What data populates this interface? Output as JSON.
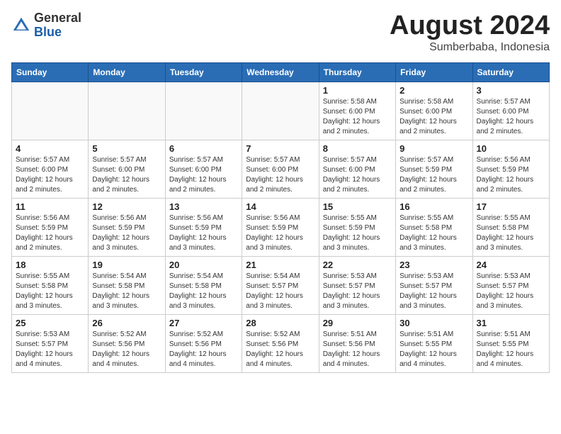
{
  "header": {
    "logo_general": "General",
    "logo_blue": "Blue",
    "calendar_title": "August 2024",
    "calendar_subtitle": "Sumberbaba, Indonesia"
  },
  "days_of_week": [
    "Sunday",
    "Monday",
    "Tuesday",
    "Wednesday",
    "Thursday",
    "Friday",
    "Saturday"
  ],
  "weeks": [
    [
      {
        "day": "",
        "info": ""
      },
      {
        "day": "",
        "info": ""
      },
      {
        "day": "",
        "info": ""
      },
      {
        "day": "",
        "info": ""
      },
      {
        "day": "1",
        "info": "Sunrise: 5:58 AM\nSunset: 6:00 PM\nDaylight: 12 hours\nand 2 minutes."
      },
      {
        "day": "2",
        "info": "Sunrise: 5:58 AM\nSunset: 6:00 PM\nDaylight: 12 hours\nand 2 minutes."
      },
      {
        "day": "3",
        "info": "Sunrise: 5:57 AM\nSunset: 6:00 PM\nDaylight: 12 hours\nand 2 minutes."
      }
    ],
    [
      {
        "day": "4",
        "info": "Sunrise: 5:57 AM\nSunset: 6:00 PM\nDaylight: 12 hours\nand 2 minutes."
      },
      {
        "day": "5",
        "info": "Sunrise: 5:57 AM\nSunset: 6:00 PM\nDaylight: 12 hours\nand 2 minutes."
      },
      {
        "day": "6",
        "info": "Sunrise: 5:57 AM\nSunset: 6:00 PM\nDaylight: 12 hours\nand 2 minutes."
      },
      {
        "day": "7",
        "info": "Sunrise: 5:57 AM\nSunset: 6:00 PM\nDaylight: 12 hours\nand 2 minutes."
      },
      {
        "day": "8",
        "info": "Sunrise: 5:57 AM\nSunset: 6:00 PM\nDaylight: 12 hours\nand 2 minutes."
      },
      {
        "day": "9",
        "info": "Sunrise: 5:57 AM\nSunset: 5:59 PM\nDaylight: 12 hours\nand 2 minutes."
      },
      {
        "day": "10",
        "info": "Sunrise: 5:56 AM\nSunset: 5:59 PM\nDaylight: 12 hours\nand 2 minutes."
      }
    ],
    [
      {
        "day": "11",
        "info": "Sunrise: 5:56 AM\nSunset: 5:59 PM\nDaylight: 12 hours\nand 2 minutes."
      },
      {
        "day": "12",
        "info": "Sunrise: 5:56 AM\nSunset: 5:59 PM\nDaylight: 12 hours\nand 3 minutes."
      },
      {
        "day": "13",
        "info": "Sunrise: 5:56 AM\nSunset: 5:59 PM\nDaylight: 12 hours\nand 3 minutes."
      },
      {
        "day": "14",
        "info": "Sunrise: 5:56 AM\nSunset: 5:59 PM\nDaylight: 12 hours\nand 3 minutes."
      },
      {
        "day": "15",
        "info": "Sunrise: 5:55 AM\nSunset: 5:59 PM\nDaylight: 12 hours\nand 3 minutes."
      },
      {
        "day": "16",
        "info": "Sunrise: 5:55 AM\nSunset: 5:58 PM\nDaylight: 12 hours\nand 3 minutes."
      },
      {
        "day": "17",
        "info": "Sunrise: 5:55 AM\nSunset: 5:58 PM\nDaylight: 12 hours\nand 3 minutes."
      }
    ],
    [
      {
        "day": "18",
        "info": "Sunrise: 5:55 AM\nSunset: 5:58 PM\nDaylight: 12 hours\nand 3 minutes."
      },
      {
        "day": "19",
        "info": "Sunrise: 5:54 AM\nSunset: 5:58 PM\nDaylight: 12 hours\nand 3 minutes."
      },
      {
        "day": "20",
        "info": "Sunrise: 5:54 AM\nSunset: 5:58 PM\nDaylight: 12 hours\nand 3 minutes."
      },
      {
        "day": "21",
        "info": "Sunrise: 5:54 AM\nSunset: 5:57 PM\nDaylight: 12 hours\nand 3 minutes."
      },
      {
        "day": "22",
        "info": "Sunrise: 5:53 AM\nSunset: 5:57 PM\nDaylight: 12 hours\nand 3 minutes."
      },
      {
        "day": "23",
        "info": "Sunrise: 5:53 AM\nSunset: 5:57 PM\nDaylight: 12 hours\nand 3 minutes."
      },
      {
        "day": "24",
        "info": "Sunrise: 5:53 AM\nSunset: 5:57 PM\nDaylight: 12 hours\nand 3 minutes."
      }
    ],
    [
      {
        "day": "25",
        "info": "Sunrise: 5:53 AM\nSunset: 5:57 PM\nDaylight: 12 hours\nand 4 minutes."
      },
      {
        "day": "26",
        "info": "Sunrise: 5:52 AM\nSunset: 5:56 PM\nDaylight: 12 hours\nand 4 minutes."
      },
      {
        "day": "27",
        "info": "Sunrise: 5:52 AM\nSunset: 5:56 PM\nDaylight: 12 hours\nand 4 minutes."
      },
      {
        "day": "28",
        "info": "Sunrise: 5:52 AM\nSunset: 5:56 PM\nDaylight: 12 hours\nand 4 minutes."
      },
      {
        "day": "29",
        "info": "Sunrise: 5:51 AM\nSunset: 5:56 PM\nDaylight: 12 hours\nand 4 minutes."
      },
      {
        "day": "30",
        "info": "Sunrise: 5:51 AM\nSunset: 5:55 PM\nDaylight: 12 hours\nand 4 minutes."
      },
      {
        "day": "31",
        "info": "Sunrise: 5:51 AM\nSunset: 5:55 PM\nDaylight: 12 hours\nand 4 minutes."
      }
    ]
  ]
}
